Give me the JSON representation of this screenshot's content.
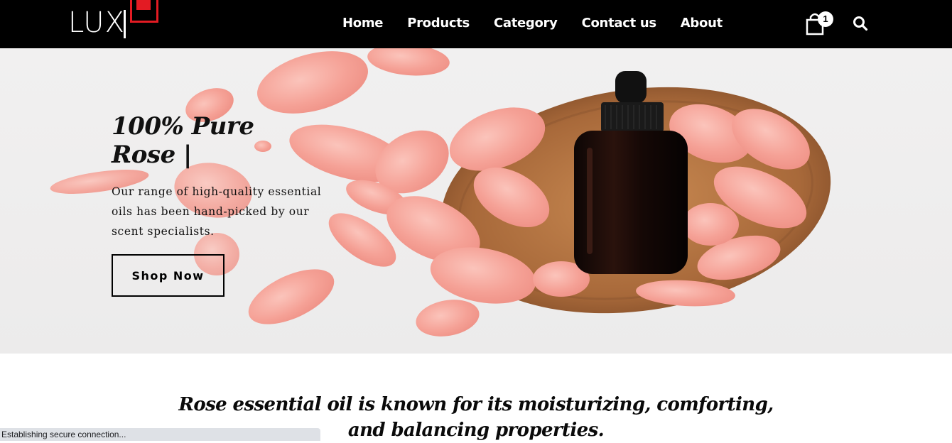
{
  "header": {
    "logo_text": "LUX",
    "nav": [
      "Home",
      "Products",
      "Category",
      "Contact us",
      "About"
    ],
    "cart_count": "1",
    "icons": {
      "cart": "shopping-bag-icon",
      "search": "search-icon"
    }
  },
  "hero": {
    "title_line1": "100% Pure",
    "title_line2": "Rose |",
    "description": "Our range of high-quality essential oils has been hand-picked by our scent specialists.",
    "button_label": "Shop Now"
  },
  "tagline": {
    "line1": "Rose essential oil is known for its moisturizing, comforting,",
    "line2": "and balancing properties."
  },
  "status_bar": {
    "text": "Establishing secure connection..."
  },
  "colors": {
    "header_bg": "#000000",
    "accent": "#e31b23",
    "petal": "#f6a8a0",
    "wood": "#a8693a"
  }
}
